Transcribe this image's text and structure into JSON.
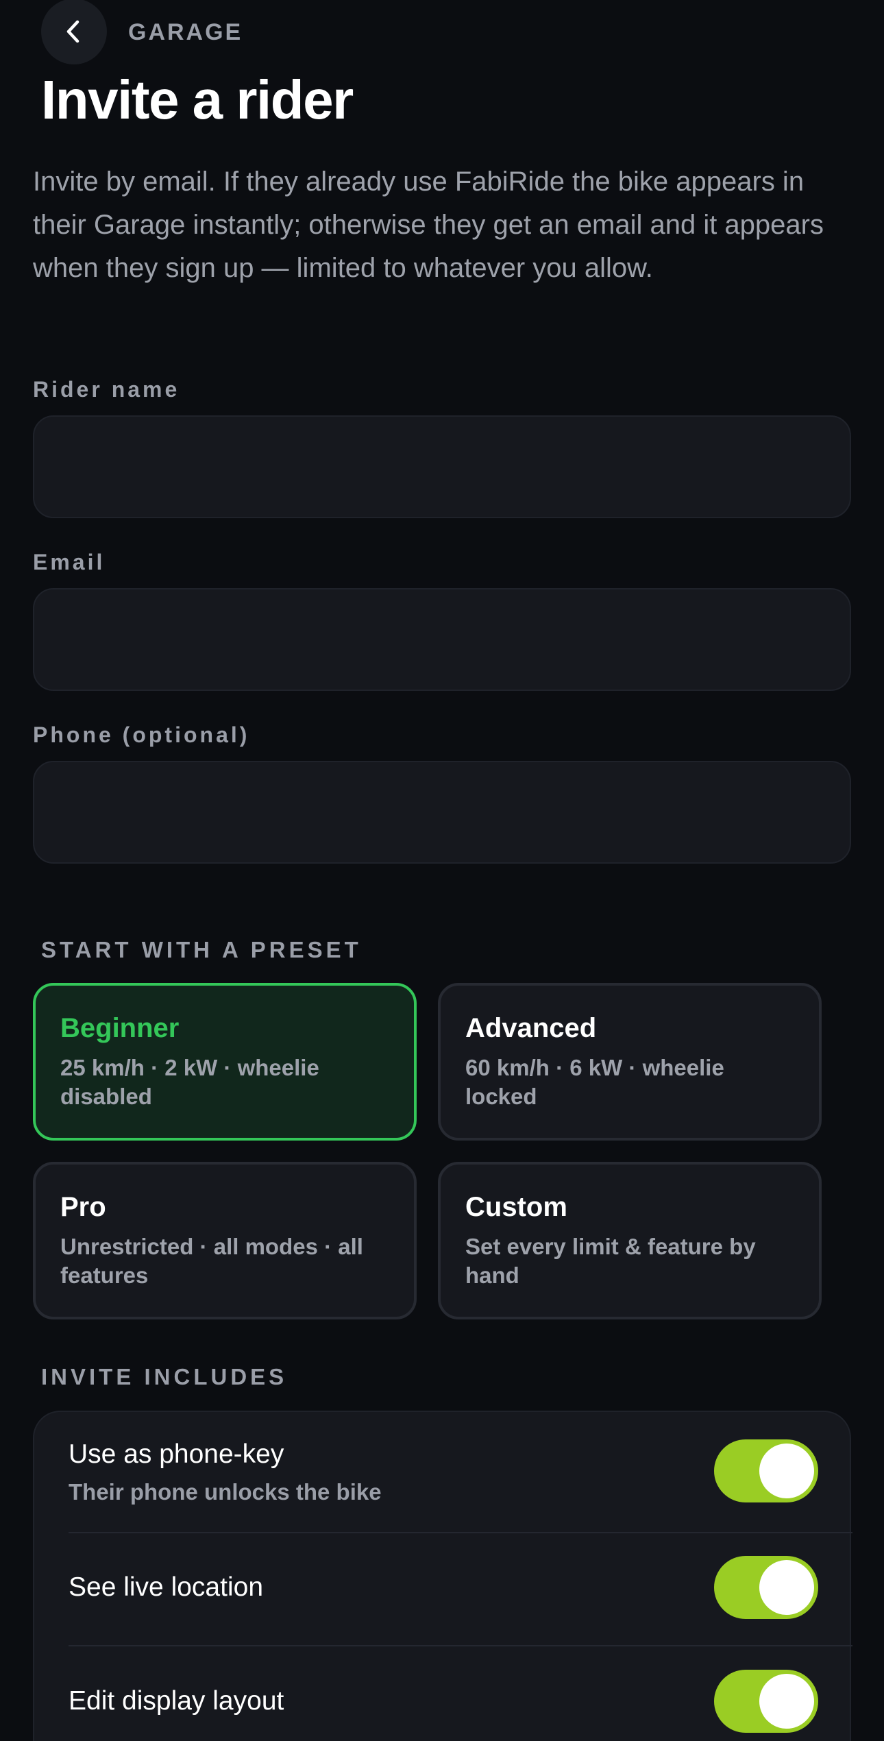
{
  "header": {
    "breadcrumb": "GARAGE",
    "title": "Invite a rider",
    "back_icon": "chevron-left-icon"
  },
  "intro": "Invite by email. If they already use FabiRide the bike appears in their Garage instantly; otherwise they get an email and it appears when they sign up — limited to whatever you allow.",
  "fields": {
    "name": {
      "label": "Rider name",
      "value": "",
      "placeholder": ""
    },
    "email": {
      "label": "Email",
      "value": "",
      "placeholder": ""
    },
    "phone": {
      "label": "Phone (optional)",
      "value": "",
      "placeholder": ""
    }
  },
  "presets": {
    "header": "START WITH A PRESET",
    "selected": "Beginner",
    "items": [
      {
        "name": "Beginner",
        "desc": "25 km/h · 2 kW · wheelie disabled"
      },
      {
        "name": "Advanced",
        "desc": "60 km/h · 6 kW · wheelie locked"
      },
      {
        "name": "Pro",
        "desc": "Unrestricted · all modes · all features"
      },
      {
        "name": "Custom",
        "desc": "Set every limit & feature by hand"
      }
    ]
  },
  "includes": {
    "header": "INVITE INCLUDES",
    "items": [
      {
        "title": "Use as phone-key",
        "subtitle": "Their phone unlocks the bike",
        "enabled": true
      },
      {
        "title": "See live location",
        "enabled": true
      },
      {
        "title": "Edit display layout",
        "enabled": true
      }
    ]
  },
  "colors": {
    "background": "#0b0d11",
    "accent_green": "#34c759",
    "toggle_on": "#9acd24"
  }
}
